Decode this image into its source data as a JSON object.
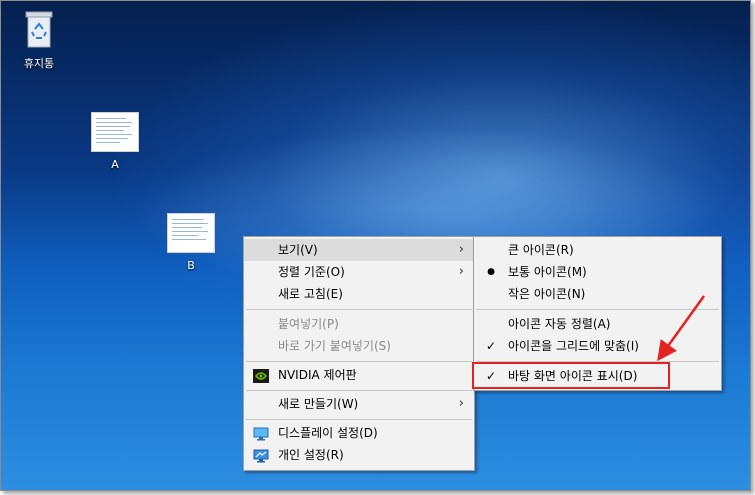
{
  "desktop": {
    "recycle_bin_label": "휴지통",
    "file_a_label": "A",
    "file_b_label": "B"
  },
  "context_menu": {
    "items": [
      {
        "label": "보기(V)"
      },
      {
        "label": "정렬 기준(O)"
      },
      {
        "label": "새로 고침(E)"
      },
      {
        "label": "붙여넣기(P)"
      },
      {
        "label": "바로 가기 붙여넣기(S)"
      },
      {
        "label": "NVIDIA 제어판"
      },
      {
        "label": "새로 만들기(W)"
      },
      {
        "label": "디스플레이 설정(D)"
      },
      {
        "label": "개인 설정(R)"
      }
    ]
  },
  "view_submenu": {
    "items": [
      {
        "label": "큰 아이콘(R)"
      },
      {
        "label": "보통 아이콘(M)",
        "mark": "●"
      },
      {
        "label": "작은 아이콘(N)"
      },
      {
        "label": "아이콘 자동 정렬(A)"
      },
      {
        "label": "아이콘을 그리드에 맞춤(I)",
        "mark": "✓"
      },
      {
        "label": "바탕 화면 아이콘 표시(D)",
        "mark": "✓"
      }
    ]
  },
  "annotation": {
    "color": "#e52222"
  },
  "icons": {
    "submenu_arrow": "›",
    "recycle": "recycle-bin-icon",
    "nvidia": "nvidia-icon",
    "display": "display-settings-icon",
    "personalize": "personalize-icon"
  }
}
